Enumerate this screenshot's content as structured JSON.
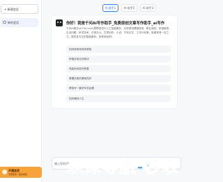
{
  "sidebar": {
    "new_chat_label": "+ 新建会话",
    "conversations": [
      {
        "label": "新的会话"
      }
    ],
    "promo": {
      "title": "开通会员",
      "subtitle": "无限使用 / 更多模型"
    }
  },
  "tabs": [
    {
      "label": "AI 助手1",
      "active": true
    },
    {
      "label": "AI 助手2",
      "active": false
    },
    {
      "label": "AI 助手3",
      "active": false
    }
  ],
  "chat": {
    "title": "你好！我是千问AI写作助手_免费原创文章写作助手_ai写作",
    "description": "千问AI助手(ai73x.com)是帮您进行人工智能服务，为您提供健康咨询、职业规划、机械维修、生活问题、科学技术、日常办公、文章创作、小说、节本论文、工作计划等，能做到有一定之力，提供多方位的智能服务。快来体验吧!",
    "suggestions": [
      "如何使用商城消费版",
      "种植农商业的秘诀",
      "电脑系统如何修复",
      "健康饮食的基础知识",
      "帮我写一篇学年总结稿",
      "如何赚钱人生"
    ]
  },
  "input": {
    "placeholder": "输入您的问题..."
  },
  "watermark": "玖涞导航-秒收"
}
